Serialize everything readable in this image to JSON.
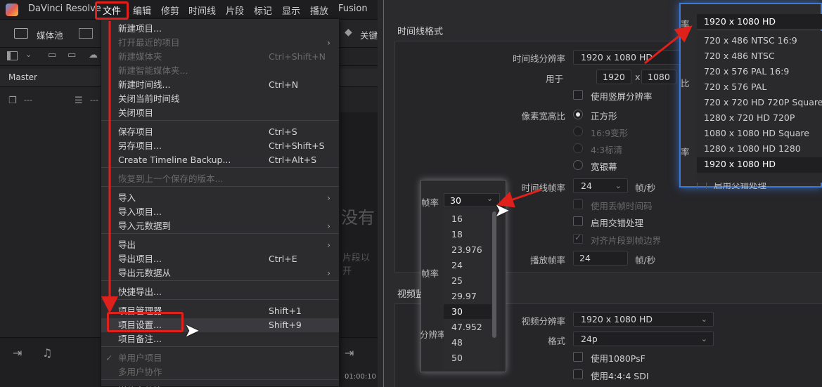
{
  "menubar": {
    "app_name": "DaVinci Resolve",
    "items": [
      "文件",
      "编辑",
      "修剪",
      "时间线",
      "片段",
      "标记",
      "显示",
      "播放",
      "Fusion"
    ]
  },
  "toolbar": {
    "media_pool": "媒体池",
    "keyframes_partial": "关键"
  },
  "master_label": "Master",
  "row3": {
    "a": "---",
    "b": "---"
  },
  "file_menu": {
    "items": [
      {
        "label": "新建项目...",
        "shortcut": "",
        "arrow": false,
        "enabled": true
      },
      {
        "label": "打开最近的项目",
        "shortcut": "",
        "arrow": true,
        "enabled": false
      },
      {
        "label": "新建媒体夹",
        "shortcut": "Ctrl+Shift+N",
        "arrow": false,
        "enabled": false
      },
      {
        "label": "新建智能媒体夹...",
        "shortcut": "",
        "arrow": false,
        "enabled": false
      },
      {
        "label": "新建时间线...",
        "shortcut": "Ctrl+N",
        "arrow": false,
        "enabled": true
      },
      {
        "label": "关闭当前时间线",
        "shortcut": "",
        "arrow": false,
        "enabled": true
      },
      {
        "label": "关闭项目",
        "shortcut": "",
        "arrow": false,
        "enabled": true
      },
      {
        "label": "保存项目",
        "shortcut": "Ctrl+S",
        "arrow": false,
        "enabled": true
      },
      {
        "label": "另存项目...",
        "shortcut": "Ctrl+Shift+S",
        "arrow": false,
        "enabled": true
      },
      {
        "label": "Create Timeline Backup...",
        "shortcut": "Ctrl+Alt+S",
        "arrow": false,
        "enabled": true
      },
      {
        "label": "恢复到上一个保存的版本...",
        "shortcut": "",
        "arrow": false,
        "enabled": false
      },
      {
        "label": "导入",
        "shortcut": "",
        "arrow": true,
        "enabled": true
      },
      {
        "label": "导入项目...",
        "shortcut": "",
        "arrow": false,
        "enabled": true
      },
      {
        "label": "导入元数据到",
        "shortcut": "",
        "arrow": true,
        "enabled": true
      },
      {
        "label": "导出",
        "shortcut": "",
        "arrow": true,
        "enabled": true
      },
      {
        "label": "导出项目...",
        "shortcut": "Ctrl+E",
        "arrow": false,
        "enabled": true
      },
      {
        "label": "导出元数据从",
        "shortcut": "",
        "arrow": true,
        "enabled": true
      },
      {
        "label": "快捷导出...",
        "shortcut": "",
        "arrow": false,
        "enabled": true
      },
      {
        "label": "项目管理器",
        "shortcut": "Shift+1",
        "arrow": false,
        "enabled": true
      },
      {
        "label": "项目设置...",
        "shortcut": "Shift+9",
        "arrow": false,
        "enabled": true
      },
      {
        "label": "项目备注...",
        "shortcut": "",
        "arrow": false,
        "enabled": true
      },
      {
        "label": "单用户项目",
        "shortcut": "",
        "arrow": false,
        "enabled": false
      },
      {
        "label": "多用户协作",
        "shortcut": "",
        "arrow": false,
        "enabled": false
      },
      {
        "label": "媒体文件管理...",
        "shortcut": "",
        "arrow": false,
        "enabled": true
      }
    ]
  },
  "bg_text": {
    "no_clip": "没有",
    "hint": "片段以开"
  },
  "timecode_partial": "01:00:10",
  "settings": {
    "timeline_format_title": "时间线格式",
    "timeline_resolution_label": "时间线分辨率",
    "timeline_resolution_value": "1920 x 1080 HD",
    "for_label": "用于",
    "width": "1920",
    "x_sep": "x",
    "height": "1080",
    "vertical_res_label": "使用竖屏分辨率",
    "pixel_aspect_label": "像素宽高比",
    "aspect_options": [
      {
        "label": "正方形",
        "selected": true,
        "enabled": true
      },
      {
        "label": "16:9变形",
        "selected": false,
        "enabled": false
      },
      {
        "label": "4:3标清",
        "selected": false,
        "enabled": false
      },
      {
        "label": "宽银幕",
        "selected": false,
        "enabled": true
      }
    ],
    "timeline_fps_label": "时间线帧率",
    "timeline_fps_value": "24",
    "fps_unit": "帧/秒",
    "drop_frame_label": "使用丢帧时间码",
    "interlace_label": "启用交错处理",
    "interlace_label_partial": "启用交错处理",
    "snap_label": "对齐片段到帧边界",
    "playback_fps_label": "播放帧率",
    "playback_fps_value": "24",
    "playback_fps_unit": "帧/秒",
    "video_monitor_title_partial": "视频监",
    "video_res_label": "视频分辨率",
    "video_res_value": "1920 x 1080 HD",
    "format_label": "格式",
    "format_value": "24p",
    "use_psf_label": "使用1080PsF",
    "use_444_label": "使用4:4:4 SDI",
    "partial_rate": "率",
    "partial_ratio": "比",
    "partial_rate2": "率"
  },
  "resolution_popup": {
    "header": "1920 x 1080 HD",
    "options": [
      "720 x 486 NTSC 16:9",
      "720 x 486 NTSC",
      "720 x 576 PAL 16:9",
      "720 x 576 PAL",
      "720 x 720 HD 720P Square",
      "1280 x 720 HD 720P",
      "1080 x 1080 HD Square",
      "1280 x 1080 HD 1280",
      "1920 x 1080 HD"
    ],
    "selected": "1920 x 1080 HD"
  },
  "fps_popup": {
    "label": "帧率",
    "label2": "帧率",
    "label3": "分辨率",
    "current": "30",
    "options": [
      "16",
      "18",
      "23.976",
      "24",
      "25",
      "29.97",
      "30",
      "47.952",
      "48",
      "50"
    ],
    "selected": "30"
  },
  "colors": {
    "accent_red": "#e0211b",
    "accent_blue": "#3c78d8"
  }
}
